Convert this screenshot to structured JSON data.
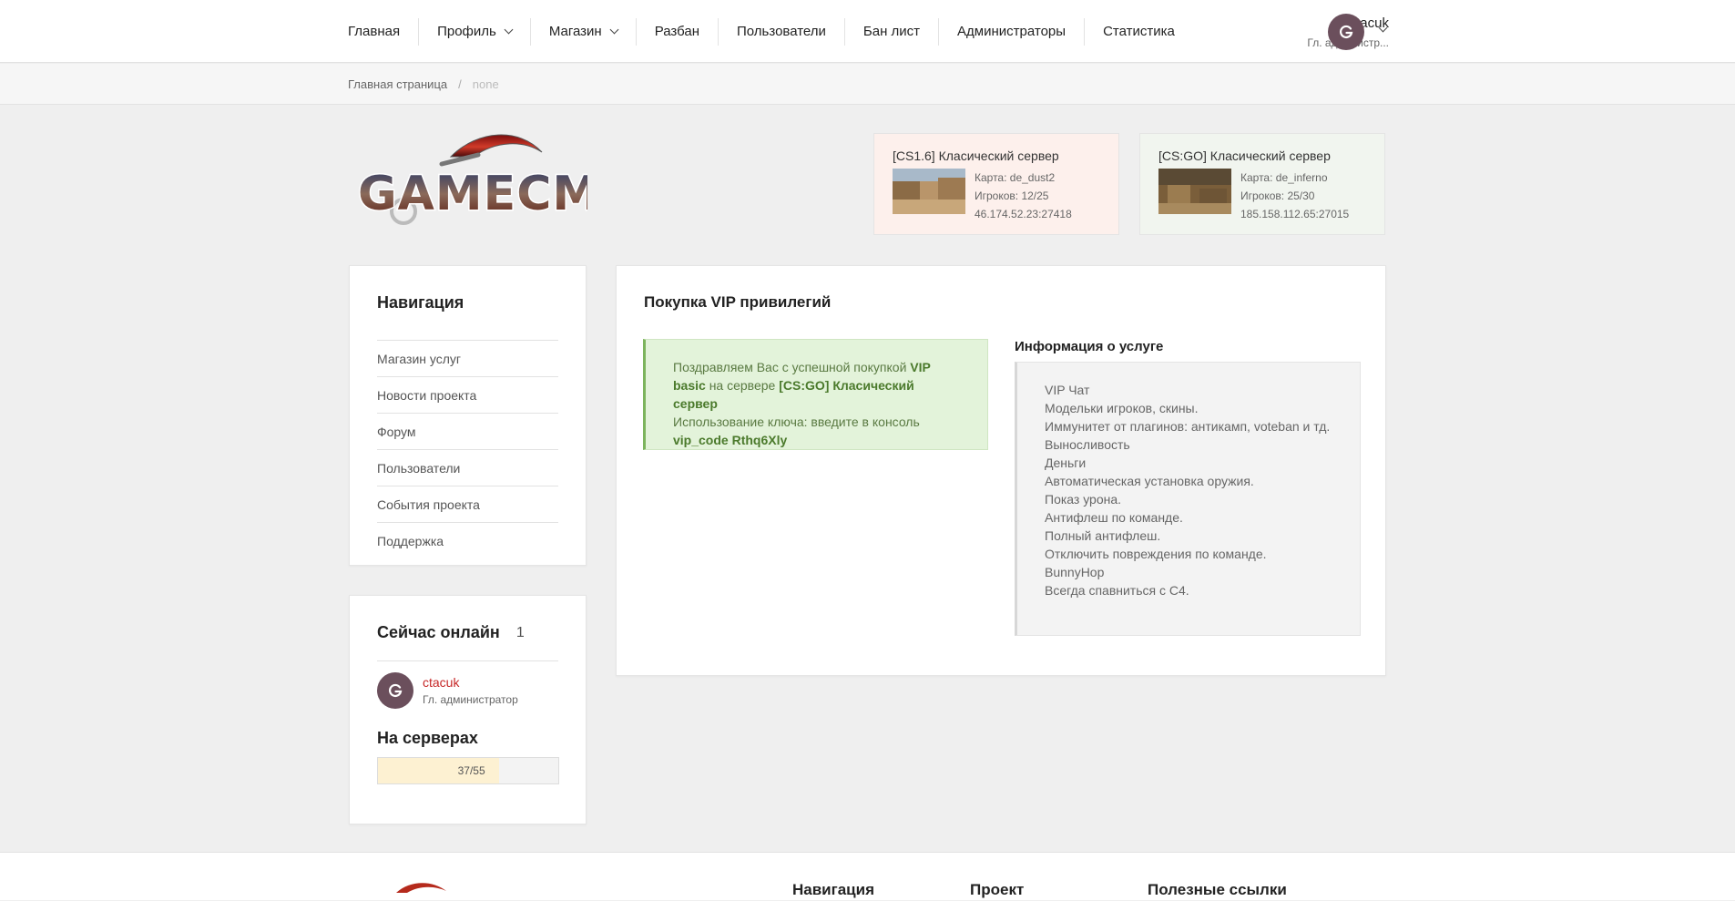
{
  "nav": {
    "items": [
      {
        "label": "Главная",
        "dropdown": false
      },
      {
        "label": "Профиль",
        "dropdown": true
      },
      {
        "label": "Магазин",
        "dropdown": true
      },
      {
        "label": "Разбан",
        "dropdown": false
      },
      {
        "label": "Пользователи",
        "dropdown": false
      },
      {
        "label": "Бан лист",
        "dropdown": false
      },
      {
        "label": "Администраторы",
        "dropdown": false
      },
      {
        "label": "Статистика",
        "dropdown": false
      }
    ],
    "user": {
      "name": "ctacuk",
      "role": "Гл. администр..."
    }
  },
  "breadcrumb": {
    "home": "Главная страница",
    "separator": "/",
    "current": "none"
  },
  "logo": {
    "text": "GAMECMS"
  },
  "servers": [
    {
      "title": "[CS1.6] Класический сервер",
      "map": "Карта: de_dust2",
      "players": "Игроков: 12/25",
      "address": "46.174.52.23:27418"
    },
    {
      "title": "[CS:GO] Класический сервер",
      "map": "Карта: de_inferno",
      "players": "Игроков: 25/30",
      "address": "185.158.112.65:27015"
    }
  ],
  "sidebar": {
    "title": "Навигация",
    "items": [
      "Магазин услуг",
      "Новости проекта",
      "Форум",
      "Пользователи",
      "События проекта",
      "Поддержка"
    ]
  },
  "online": {
    "title": "Сейчас онлайн",
    "count": "1",
    "user": {
      "name": "ctacuk",
      "role": "Гл. администратор"
    },
    "servers_title": "На серверах",
    "servers_value": "37/55",
    "servers_fraction": 0.673
  },
  "main": {
    "title": "Покупка VIP привилегий",
    "success": {
      "t1": "Поздравляем Вас с успешной покупкой ",
      "b1": "VIP basic",
      "t2": " на сервере ",
      "b2": "[CS:GO] Класический сервер",
      "t3": "Использование ключа: введите в консоль",
      "b3": "vip_code Rthq6Xly"
    },
    "info_title": "Информация о услуге",
    "info_items": [
      "VIP Чат",
      "Модельки игроков, скины.",
      "Иммунитет от плагинов: антикамп, voteban и тд.",
      "Выносливость",
      "Деньги",
      "Автоматическая установка оружия.",
      "Показ урона.",
      "Антифлеш по команде.",
      "Полный антифлеш.",
      "Отключить повреждения по команде.",
      "BunnyHop",
      "Всегда спавниться с С4."
    ]
  },
  "footer": {
    "col1": "Навигация",
    "col2": "Проект",
    "col3": "Полезные ссылки"
  },
  "colors": {
    "accent_red": "#c62828",
    "success_bg": "#e3f3da",
    "avatar": "#6b4f5c"
  }
}
